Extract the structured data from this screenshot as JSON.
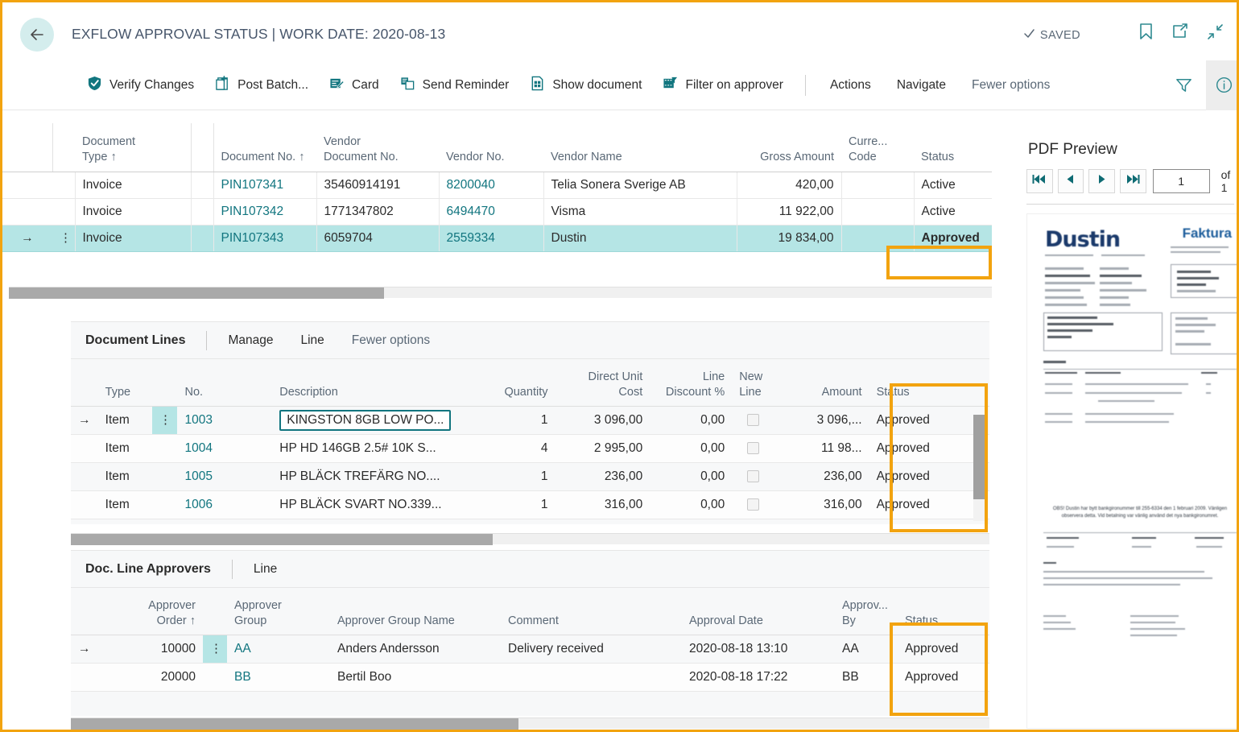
{
  "header": {
    "back_icon": "arrow-left-icon",
    "title": "EXFLOW APPROVAL STATUS | WORK DATE: 2020-08-13",
    "saved_label": "SAVED",
    "saved_icon": "check-icon",
    "icons": [
      "bookmark-icon",
      "open-in-new-window-icon",
      "collapse-icon"
    ]
  },
  "command_bar": {
    "actions": [
      {
        "label": "Verify Changes",
        "icon": "verify-shield-icon"
      },
      {
        "label": "Post Batch...",
        "icon": "post-batch-icon"
      },
      {
        "label": "Card",
        "icon": "card-edit-icon"
      },
      {
        "label": "Send Reminder",
        "icon": "send-reminder-icon"
      },
      {
        "label": "Show document",
        "icon": "show-document-icon"
      },
      {
        "label": "Filter on approver",
        "icon": "filter-approver-icon"
      }
    ],
    "menus": [
      "Actions",
      "Navigate",
      "Fewer options"
    ],
    "filter_icon": "funnel-icon",
    "info_icon": "info-circle-icon"
  },
  "documents_grid": {
    "columns": [
      {
        "key": "document_type",
        "label": "Document Type ↑",
        "line1": "Document",
        "line2": "Type ↑",
        "align": "left"
      },
      {
        "key": "document_no",
        "label": "Document No. ↑",
        "line1": "Document No. ↑",
        "line2": "",
        "align": "left"
      },
      {
        "key": "vendor_document_no",
        "label": "Vendor Document No.",
        "line1": "Vendor",
        "line2": "Document No.",
        "align": "left"
      },
      {
        "key": "vendor_no",
        "label": "Vendor No.",
        "line1": "",
        "line2": "Vendor No.",
        "align": "left"
      },
      {
        "key": "vendor_name",
        "label": "Vendor Name",
        "line1": "",
        "line2": "Vendor Name",
        "align": "left"
      },
      {
        "key": "gross_amount",
        "label": "Gross Amount",
        "line1": "",
        "line2": "Gross Amount",
        "align": "right"
      },
      {
        "key": "currency_code",
        "label": "Curre... Code",
        "line1": "Curre...",
        "line2": "Code",
        "align": "left"
      },
      {
        "key": "status",
        "label": "Status",
        "line1": "",
        "line2": "Status",
        "align": "left"
      }
    ],
    "rows": [
      {
        "selected": false,
        "document_type": "Invoice",
        "document_no": "PIN107341",
        "vendor_document_no": "35460914191",
        "vendor_no": "8200040",
        "vendor_name": "Telia Sonera Sverige AB",
        "gross_amount": "420,00",
        "currency_code": "",
        "status": "Active"
      },
      {
        "selected": false,
        "document_type": "Invoice",
        "document_no": "PIN107342",
        "vendor_document_no": "1771347802",
        "vendor_no": "6494470",
        "vendor_name": "Visma",
        "gross_amount": "11 922,00",
        "currency_code": "",
        "status": "Active"
      },
      {
        "selected": true,
        "row_indicator": "→",
        "row_menu_icon": "vertical-dots-icon",
        "document_type": "Invoice",
        "document_no": "PIN107343",
        "vendor_document_no": "6059704",
        "vendor_no": "2559334",
        "vendor_name": "Dustin",
        "gross_amount": "19 834,00",
        "currency_code": "",
        "status": "Approved"
      }
    ]
  },
  "document_lines": {
    "part_title": "Document Lines",
    "tabs": [
      "Manage",
      "Line",
      "Fewer options"
    ],
    "columns": [
      {
        "key": "type",
        "label": "Type",
        "line1": "",
        "line2": "Type",
        "align": "left"
      },
      {
        "key": "no",
        "label": "No.",
        "line1": "",
        "line2": "No.",
        "align": "left"
      },
      {
        "key": "description",
        "label": "Description",
        "line1": "",
        "line2": "Description",
        "align": "left"
      },
      {
        "key": "quantity",
        "label": "Quantity",
        "line1": "",
        "line2": "Quantity",
        "align": "right"
      },
      {
        "key": "direct_unit_cost",
        "label": "Direct Unit Cost",
        "line1": "Direct Unit",
        "line2": "Cost",
        "align": "right"
      },
      {
        "key": "line_discount_pct",
        "label": "Line Discount %",
        "line1": "Line",
        "line2": "Discount %",
        "align": "right"
      },
      {
        "key": "new_line",
        "label": "New Line",
        "line1": "New",
        "line2": "Line",
        "align": "left"
      },
      {
        "key": "amount",
        "label": "Amount",
        "line1": "",
        "line2": "Amount",
        "align": "right"
      },
      {
        "key": "status",
        "label": "Status",
        "line1": "",
        "line2": "Status",
        "align": "left"
      }
    ],
    "rows": [
      {
        "selected": true,
        "row_indicator": "→",
        "row_menu_icon": "vertical-dots-icon",
        "type": "Item",
        "no": "1003",
        "description": "KINGSTON 8GB LOW PO...",
        "description_focused": true,
        "quantity": "1",
        "direct_unit_cost": "3 096,00",
        "line_discount_pct": "0,00",
        "new_line": false,
        "amount": "3 096,...",
        "status": "Approved"
      },
      {
        "selected": false,
        "type": "Item",
        "no": "1004",
        "description": "HP HD 146GB 2.5# 10K S...",
        "description_focused": false,
        "quantity": "4",
        "direct_unit_cost": "2 995,00",
        "line_discount_pct": "0,00",
        "new_line": false,
        "amount": "11 98...",
        "status": "Approved"
      },
      {
        "selected": false,
        "type": "Item",
        "no": "1005",
        "description": "HP BLÄCK TREFÄRG NO....",
        "description_focused": false,
        "quantity": "1",
        "direct_unit_cost": "236,00",
        "line_discount_pct": "0,00",
        "new_line": false,
        "amount": "236,00",
        "status": "Approved"
      },
      {
        "selected": false,
        "type": "Item",
        "no": "1006",
        "description": "HP BLÄCK SVART NO.339...",
        "description_focused": false,
        "quantity": "1",
        "direct_unit_cost": "316,00",
        "line_discount_pct": "0,00",
        "new_line": false,
        "amount": "316,00",
        "status": "Approved"
      }
    ]
  },
  "doc_line_approvers": {
    "part_title": "Doc. Line Approvers",
    "tabs": [
      "Line"
    ],
    "columns": [
      {
        "key": "approver_order",
        "label": "Approver Order ↑",
        "line1": "Approver",
        "line2": "Order ↑",
        "align": "right"
      },
      {
        "key": "approver_group",
        "label": "Approver Group",
        "line1": "Approver",
        "line2": "Group",
        "align": "left"
      },
      {
        "key": "approver_group_name",
        "label": "Approver Group Name",
        "line1": "",
        "line2": "Approver Group Name",
        "align": "left"
      },
      {
        "key": "comment",
        "label": "Comment",
        "line1": "",
        "line2": "Comment",
        "align": "left"
      },
      {
        "key": "approval_date",
        "label": "Approval Date",
        "line1": "",
        "line2": "Approval Date",
        "align": "left"
      },
      {
        "key": "approved_by",
        "label": "Approv... By",
        "line1": "Approv...",
        "line2": "By",
        "align": "left"
      },
      {
        "key": "status",
        "label": "Status",
        "line1": "",
        "line2": "Status",
        "align": "left"
      }
    ],
    "rows": [
      {
        "selected": true,
        "row_indicator": "→",
        "row_menu_icon": "vertical-dots-icon",
        "approver_order": "10000",
        "approver_group": "AA",
        "approver_group_name": "Anders Andersson",
        "comment": "Delivery received",
        "approval_date": "2020-08-18 13:10",
        "approved_by": "AA",
        "status": "Approved"
      },
      {
        "selected": false,
        "approver_order": "20000",
        "approver_group": "BB",
        "approver_group_name": "Bertil Boo",
        "comment": "",
        "approval_date": "2020-08-18 17:22",
        "approved_by": "BB",
        "status": "Approved"
      }
    ]
  },
  "pdf_preview": {
    "title": "PDF Preview",
    "nav": {
      "first_icon": "first-page-icon",
      "prev_icon": "previous-page-icon",
      "next_icon": "next-page-icon",
      "last_icon": "last-page-icon",
      "page_value": "1",
      "of_label": "of 1"
    },
    "document": {
      "logo_text": "Dustin",
      "heading": "Faktura",
      "note": "OBS! Dustin har bytt bankgironummer till 255-6334 den 1 februari 2009. Vänligen observera detta. Vid betalning var vänlig använd det nya bankgironumret."
    }
  },
  "colors": {
    "accent_teal": "#11757F",
    "highlight_orange": "#F2A30F",
    "selection_cyan": "#B5E5E5",
    "approved_green": "#1B4D1B"
  }
}
